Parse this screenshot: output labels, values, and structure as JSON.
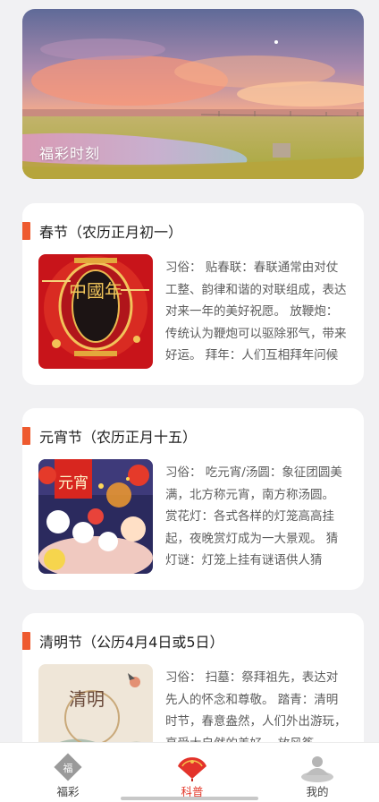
{
  "hero": {
    "caption": "福彩时刻"
  },
  "cards": [
    {
      "title": "春节（农历正月初一）",
      "description": "习俗： 贴春联：春联通常由对仗工整、韵律和谐的对联组成，表达对来一年的美好祝愿。 放鞭炮：传统认为鞭炮可以驱除邪气，带来好运。 拜年：人们互相拜年问候",
      "image_text": "中國年"
    },
    {
      "title": "元宵节（农历正月十五）",
      "description": "习俗： 吃元宵/汤圆：象征团圆美满，北方称元宵，南方称汤圆。 赏花灯：各式各样的灯笼高高挂起，夜晚赏灯成为一大景观。 猜灯谜：灯笼上挂有谜语供人猜",
      "image_text": "元宵"
    },
    {
      "title": "清明节（公历4月4日或5日）",
      "description": "习俗： 扫墓：祭拜祖先，表达对先人的怀念和尊敬。 踏青：清明时节，春意盎然，人们外出游玩，享受大自然的美好。 放风筝",
      "image_text": "清明"
    }
  ],
  "tabs": [
    {
      "label": "福彩",
      "icon": "lottery-diamond-icon",
      "active": false
    },
    {
      "label": "科普",
      "icon": "fan-icon",
      "active": true
    },
    {
      "label": "我的",
      "icon": "user-icon",
      "active": false
    }
  ],
  "colors": {
    "accent": "#ee5a2f",
    "active_tab": "#e33a2c"
  }
}
